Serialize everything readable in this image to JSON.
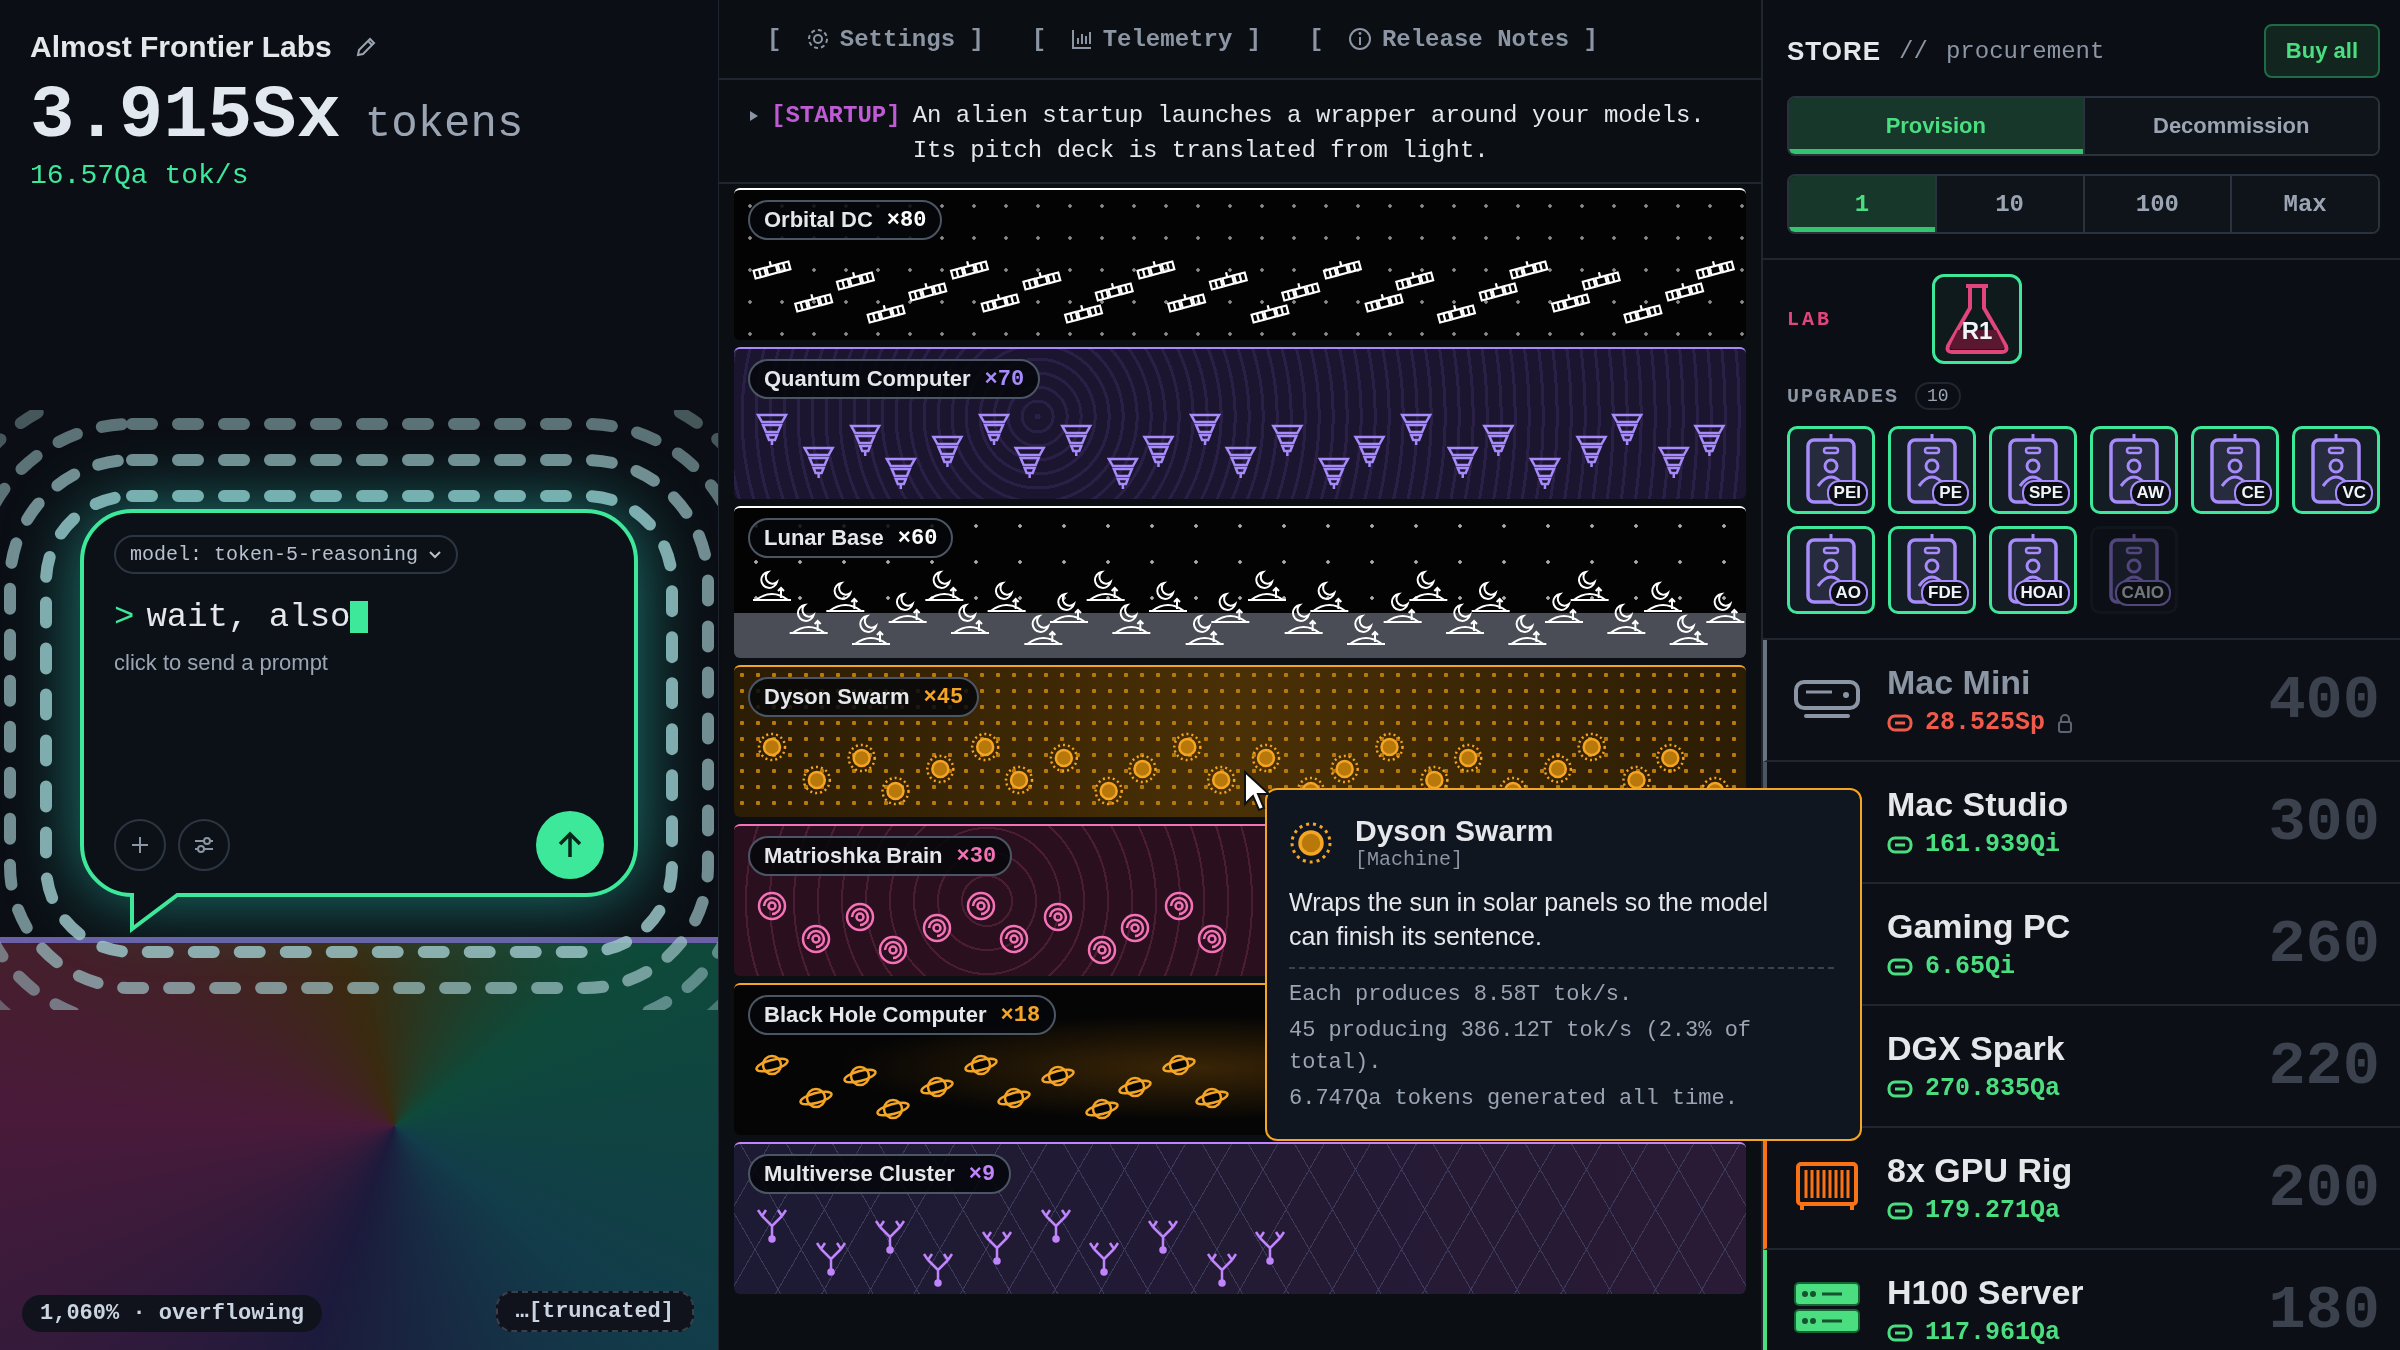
{
  "lab": {
    "name": "Almost Frontier Labs",
    "tokens": "3.915Sx",
    "unit": "tokens",
    "rate": "16.57Qa tok/s"
  },
  "prompt": {
    "model": "model: token-5-reasoning",
    "mark": ">",
    "value": "wait, also",
    "hint": "click to send a prompt"
  },
  "status": {
    "overflow": "1,060% · overflowing",
    "truncated": "…[truncated]"
  },
  "nav": [
    {
      "kind": "gear",
      "open": "[",
      "label": "Settings",
      "close": "]"
    },
    {
      "kind": "chart",
      "open": "[",
      "label": "Telemetry",
      "close": "]"
    },
    {
      "kind": "info",
      "open": "[",
      "label": "Release Notes",
      "close": "]"
    }
  ],
  "event": {
    "tag": "[STARTUP]",
    "text": "An alien startup launches a wrapper around your models. Its pitch deck is translated from light."
  },
  "machines": [
    {
      "kind": "satellite",
      "name": "Orbital DC",
      "count": "×80",
      "color": "#ffffff"
    },
    {
      "kind": "quantum",
      "name": "Quantum Computer",
      "count": "×70",
      "color": "#a78bfa"
    },
    {
      "kind": "moon",
      "name": "Lunar Base",
      "count": "×60",
      "color": "#ffffff"
    },
    {
      "kind": "sun",
      "name": "Dyson Swarm",
      "count": "×45",
      "color": "#f5a524"
    },
    {
      "kind": "spiral",
      "name": "Matrioshka Brain",
      "count": "×30",
      "color": "#f472b6"
    },
    {
      "kind": "planet",
      "name": "Black Hole Computer",
      "count": "×18",
      "color": "#f5a524"
    },
    {
      "kind": "fork",
      "name": "Multiverse Cluster",
      "count": "×9",
      "color": "#c084fc"
    }
  ],
  "tooltip": {
    "title": "Dyson Swarm",
    "subtitle": "[Machine]",
    "description": "Wraps the sun in solar panels so the model can finish its sentence.",
    "stats": [
      "Each produces 8.58T tok/s.",
      "45 producing 386.12T tok/s (2.3% of total).",
      "6.747Qa tokens generated all time."
    ]
  },
  "store": {
    "title": "STORE",
    "separator": "//",
    "subtitle": "procurement",
    "buy_all": "Buy all",
    "modes": [
      {
        "label": "Provision",
        "selected": true
      },
      {
        "label": "Decommission",
        "selected": false
      }
    ],
    "quantities": [
      {
        "label": "1",
        "selected": true
      },
      {
        "label": "10",
        "selected": false
      },
      {
        "label": "100",
        "selected": false
      },
      {
        "label": "Max",
        "selected": false
      }
    ],
    "lab_label": "LAB",
    "lab_badge": "R1",
    "upgrades_label": "UPGRADES",
    "upgrades_count": "10",
    "upgrades": [
      {
        "label": "PEI",
        "owned": true
      },
      {
        "label": "PE",
        "owned": true
      },
      {
        "label": "SPE",
        "owned": true
      },
      {
        "label": "AW",
        "owned": true
      },
      {
        "label": "CE",
        "owned": true
      },
      {
        "label": "VC",
        "owned": true
      },
      {
        "label": "AO",
        "owned": true
      },
      {
        "label": "FDE",
        "owned": true
      },
      {
        "label": "HOAI",
        "owned": true
      },
      {
        "label": "CAIO",
        "owned": false
      }
    ],
    "items": [
      {
        "kind": "mini",
        "name": "Mac Mini",
        "cost": "28.525Sp",
        "affordable": false,
        "count": "400"
      },
      {
        "kind": "studio",
        "name": "Mac Studio",
        "cost": "161.939Qi",
        "affordable": true,
        "count": "300"
      },
      {
        "kind": "pc",
        "name": "Gaming PC",
        "cost": "6.65Qi",
        "affordable": true,
        "count": "260"
      },
      {
        "kind": "spark",
        "name": "DGX Spark",
        "cost": "270.835Qa",
        "affordable": true,
        "count": "220"
      },
      {
        "kind": "rig",
        "name": "8x GPU Rig",
        "cost": "179.271Qa",
        "affordable": true,
        "count": "200"
      },
      {
        "kind": "server",
        "name": "H100 Server",
        "cost": "117.961Qa",
        "affordable": true,
        "count": "180"
      }
    ]
  }
}
